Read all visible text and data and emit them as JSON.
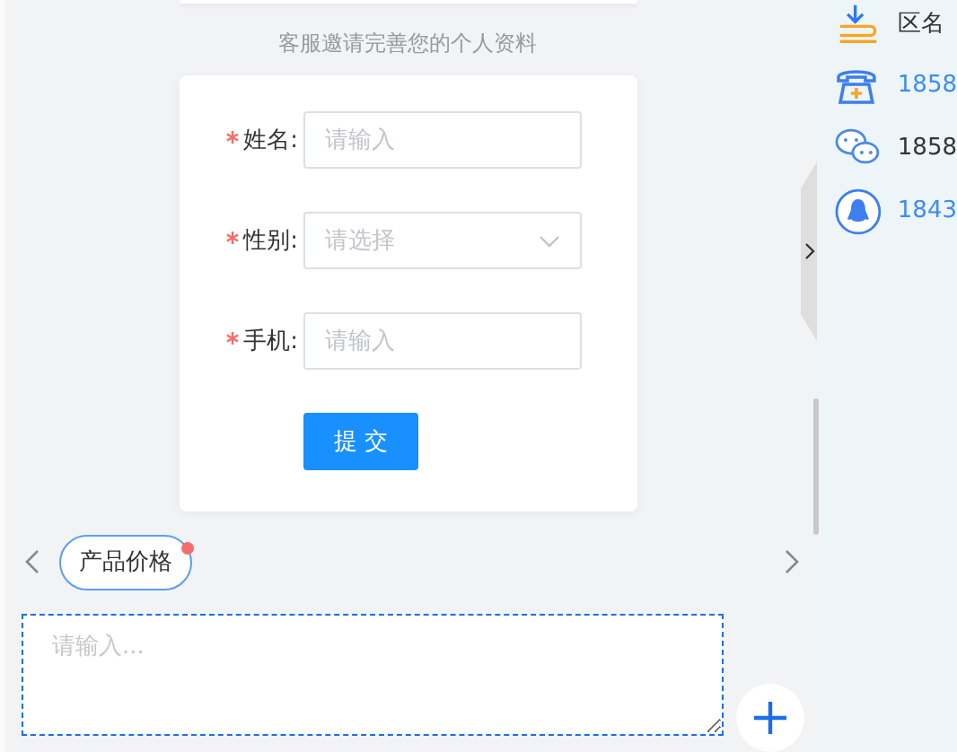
{
  "invite_text": "客服邀请完善您的个人资料",
  "form": {
    "fields": [
      {
        "kind": "input",
        "label": "姓名:",
        "required": true,
        "placeholder": "请输入"
      },
      {
        "kind": "select",
        "label": "性别:",
        "required": true,
        "placeholder": "请选择"
      },
      {
        "kind": "input",
        "label": "手机:",
        "required": true,
        "placeholder": "请输入"
      }
    ],
    "submit": "提 交"
  },
  "quick_replies": [
    {
      "label": "产品价格",
      "unread": true
    }
  ],
  "message_input": {
    "placeholder": "请输入..."
  },
  "contacts": [
    {
      "kind": "address",
      "text": "区名",
      "link": false
    },
    {
      "kind": "phone",
      "text": "1858",
      "link": true
    },
    {
      "kind": "wechat",
      "text": "1858",
      "link": false
    },
    {
      "kind": "qq",
      "text": "1843",
      "link": true
    }
  ]
}
